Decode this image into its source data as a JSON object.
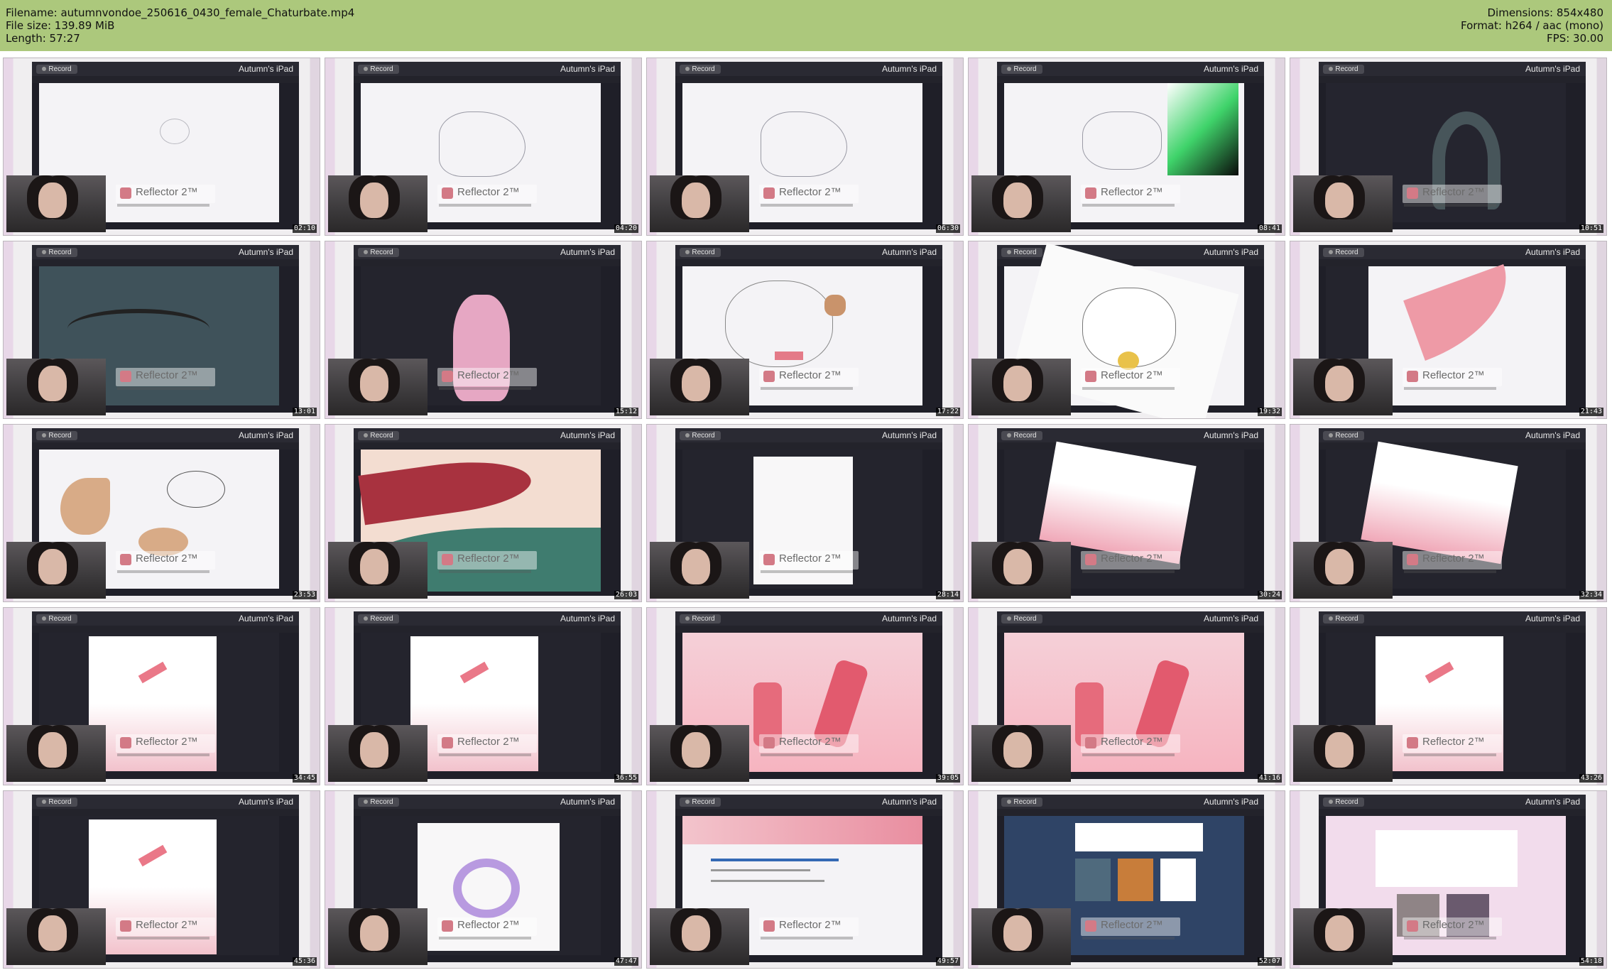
{
  "header": {
    "filename": "Filename: autumnvondoe_250616_0430_female_Chaturbate.mp4",
    "filesize": "File size: 139.89 MiB",
    "length": "Length: 57:27",
    "dimensions": "Dimensions: 854x480",
    "format": "Format: h264 / aac (mono)",
    "fps": "FPS: 30.00"
  },
  "thumb_common": {
    "record_label": "Record",
    "device_label": "Autumn's iPad",
    "watermark": "Reflector 2™"
  },
  "thumbs": [
    {
      "time": "02:10",
      "art": "sketch-circle"
    },
    {
      "time": "04:20",
      "art": "sketch-dragon"
    },
    {
      "time": "06:30",
      "art": "sketch-dragon"
    },
    {
      "time": "08:41",
      "art": "color-picker"
    },
    {
      "time": "10:51",
      "art": "dark-snake"
    },
    {
      "time": "13:01",
      "art": "dark-teal"
    },
    {
      "time": "15:12",
      "art": "pink-figure"
    },
    {
      "time": "17:22",
      "art": "cat-sketch"
    },
    {
      "time": "19:32",
      "art": "cat-color"
    },
    {
      "time": "21:43",
      "art": "pink-stroke"
    },
    {
      "time": "23:53",
      "art": "cat-closeup"
    },
    {
      "time": "26:03",
      "art": "tentacle"
    },
    {
      "time": "28:14",
      "art": "blank"
    },
    {
      "time": "30:24",
      "art": "pink-gradient"
    },
    {
      "time": "32:34",
      "art": "pink-gradient"
    },
    {
      "time": "34:45",
      "art": "crystal-small"
    },
    {
      "time": "36:55",
      "art": "crystal-small"
    },
    {
      "time": "39:05",
      "art": "crystal-big"
    },
    {
      "time": "41:16",
      "art": "crystal-big"
    },
    {
      "time": "43:26",
      "art": "crystal-small"
    },
    {
      "time": "45:36",
      "art": "crystal-small"
    },
    {
      "time": "47:47",
      "art": "purple-figure"
    },
    {
      "time": "49:57",
      "art": "web-page"
    },
    {
      "time": "52:07",
      "art": "web-dark"
    },
    {
      "time": "54:18",
      "art": "web-pink"
    }
  ],
  "colors": {
    "header_bg": "#acc87c",
    "ipad_bg": "#1f1f28",
    "timestamp_bg": "#000000"
  }
}
